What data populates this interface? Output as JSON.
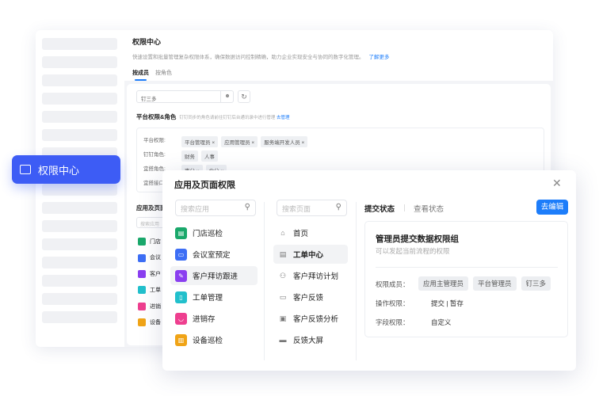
{
  "header": {
    "title": "权限中心",
    "description": "快速设置和批量管理复杂权限体系，确保数据访问控制精确，助力企业实现安全与协同的数字化管理。",
    "learn_more": "了解更多",
    "tabs": [
      {
        "label": "按成员",
        "active": true
      },
      {
        "label": "按角色",
        "active": false
      }
    ]
  },
  "member_search": {
    "value": "钉三多"
  },
  "platform": {
    "title": "平台权限&角色",
    "hint": "钉钉同步的角色请前往钉钉后台通讯录中进行管理",
    "manage": "去管理",
    "rows": [
      {
        "label": "平台权限:",
        "tags": [
          "平台管理员",
          "应用管理员",
          "服务端开发人员"
        ],
        "removable": true
      },
      {
        "label": "钉钉角色:",
        "tags": [
          "财务",
          "人事"
        ],
        "removable": false
      },
      {
        "label": "宜搭角色:",
        "tags": [
          "南分",
          "北分"
        ],
        "removable": true
      },
      {
        "label": "宜搭接口"
      }
    ]
  },
  "back_apps": {
    "title": "应用及页面",
    "search_placeholder": "搜索应用",
    "items": [
      "门店",
      "会议",
      "客户",
      "工单",
      "进销",
      "设备"
    ]
  },
  "badge": {
    "label": "权限中心",
    "icon": "permission-card-icon",
    "color": "#3d5cf5"
  },
  "modal": {
    "title": "应用及页面权限",
    "app_search_placeholder": "搜索应用",
    "page_search_placeholder": "搜索页面",
    "apps": [
      {
        "label": "门店巡检",
        "color": "#1aa86b",
        "icon": "store-icon"
      },
      {
        "label": "会议室预定",
        "color": "#3d6ef5",
        "icon": "monitor-icon"
      },
      {
        "label": "客户拜访跟进",
        "color": "#8a3ff0",
        "icon": "edit-doc-icon",
        "selected": true
      },
      {
        "label": "工单管理",
        "color": "#22c0cc",
        "icon": "document-icon"
      },
      {
        "label": "进销存",
        "color": "#ee3f8f",
        "icon": "basket-icon"
      },
      {
        "label": "设备巡检",
        "color": "#f0a417",
        "icon": "building-icon"
      }
    ],
    "pages": [
      {
        "label": "首页",
        "icon": "home-icon"
      },
      {
        "label": "工单中心",
        "icon": "file-icon",
        "selected": true
      },
      {
        "label": "客户拜访计划",
        "icon": "org-chart-icon"
      },
      {
        "label": "客户反馈",
        "icon": "window-icon"
      },
      {
        "label": "客户反馈分析",
        "icon": "chart-doc-icon"
      },
      {
        "label": "反馈大屏",
        "icon": "screen-icon"
      }
    ],
    "tabs": [
      {
        "label": "提交状态",
        "active": true
      },
      {
        "label": "查看状态",
        "active": false
      }
    ],
    "edit_button": "去编辑",
    "perm": {
      "title": "管理员提交数据权限组",
      "subtitle": "可以发起当前流程的权限",
      "members_label": "权限成员：",
      "members": [
        "应用主管理员",
        "平台管理员",
        "钉三多"
      ],
      "ops_label": "操作权限：",
      "ops": "提交 | 暂存",
      "fields_label": "字段权限：",
      "fields": "自定义"
    }
  }
}
